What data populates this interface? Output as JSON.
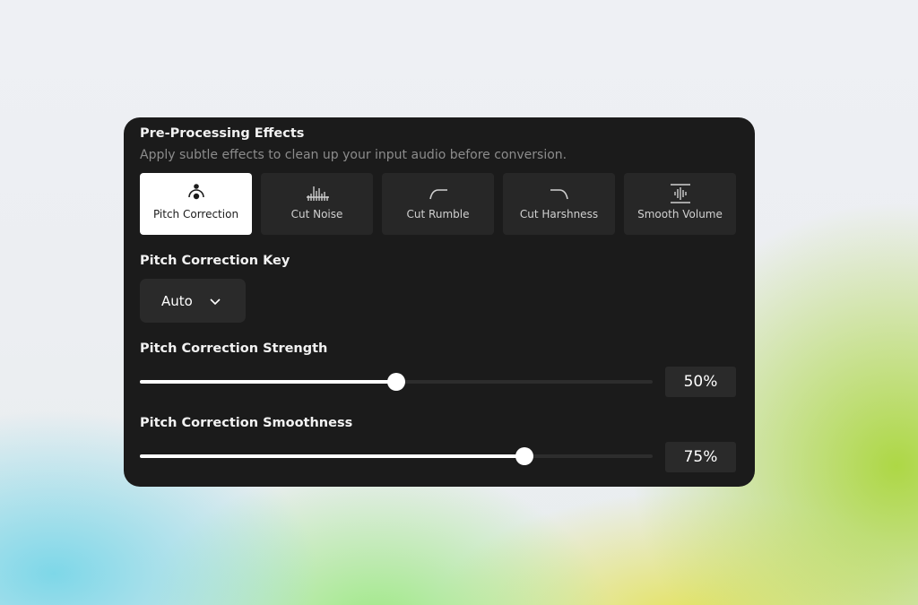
{
  "panel": {
    "title": "Pre-Processing Effects",
    "subtitle": "Apply subtle effects to clean up your input audio before conversion."
  },
  "effects": [
    {
      "label": "Pitch Correction",
      "icon": "pitch-correction-icon",
      "active": true
    },
    {
      "label": "Cut Noise",
      "icon": "noise-bars-icon",
      "active": false
    },
    {
      "label": "Cut Rumble",
      "icon": "low-cut-curve-icon",
      "active": false
    },
    {
      "label": "Cut Harshness",
      "icon": "high-cut-curve-icon",
      "active": false
    },
    {
      "label": "Smooth Volume",
      "icon": "waveform-icon",
      "active": false
    }
  ],
  "pitch_key": {
    "label": "Pitch Correction Key",
    "value": "Auto"
  },
  "strength": {
    "label": "Pitch Correction Strength",
    "value_text": "50%",
    "percent": 50
  },
  "smoothness": {
    "label": "Pitch Correction Smoothness",
    "value_text": "75%",
    "percent": 75
  },
  "colors": {
    "panel_bg": "#1b1b1b",
    "tile_bg": "#272727",
    "active_tile": "#ffffff",
    "muted_text": "#8c8c8c"
  }
}
